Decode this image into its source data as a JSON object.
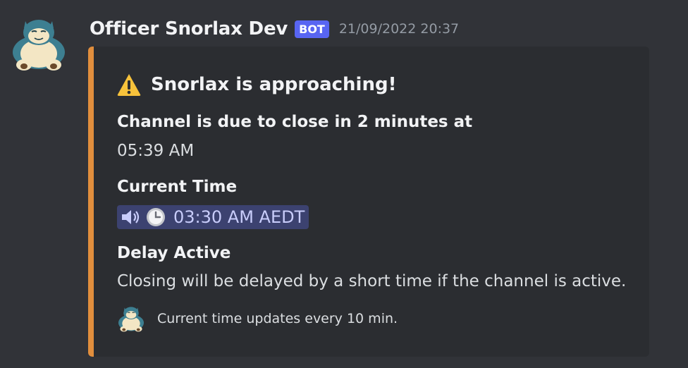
{
  "message": {
    "author": "Officer Snorlax Dev",
    "bot_badge": "BOT",
    "timestamp": "21/09/2022 20:37",
    "avatar_icon": "snorlax-avatar-icon"
  },
  "embed": {
    "accent_color": "#e18e3d",
    "title_icon": "warning-icon",
    "title": "Snorlax is approaching!",
    "fields": [
      {
        "name": "Channel is due to close in 2 minutes at",
        "value": "05:39 AM"
      },
      {
        "name": "Current Time",
        "value": "03:30 AM AEDT"
      },
      {
        "name": "Delay Active",
        "value": "Closing will be delayed by a short time if the channel is active."
      }
    ],
    "time_mention": {
      "icons": [
        "speaker-icon",
        "clock-icon"
      ],
      "text": "03:30 AM AEDT"
    },
    "footer": {
      "icon": "snorlax-footer-icon",
      "text": "Current time updates every 10 min."
    }
  }
}
